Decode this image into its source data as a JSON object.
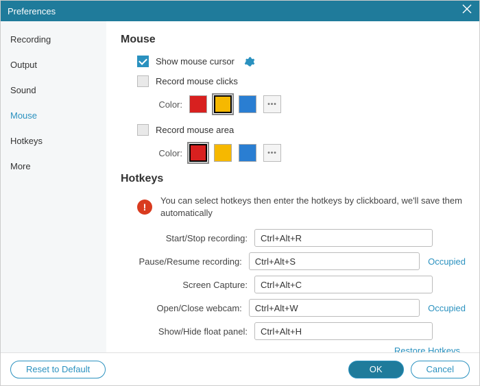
{
  "window": {
    "title": "Preferences"
  },
  "sidebar": {
    "items": [
      {
        "label": "Recording"
      },
      {
        "label": "Output"
      },
      {
        "label": "Sound"
      },
      {
        "label": "Mouse"
      },
      {
        "label": "Hotkeys"
      },
      {
        "label": "More"
      }
    ],
    "active_index": 3
  },
  "mouse": {
    "heading": "Mouse",
    "show_cursor_label": "Show mouse cursor",
    "show_cursor_checked": true,
    "record_clicks_label": "Record mouse clicks",
    "record_clicks_checked": false,
    "record_area_label": "Record mouse area",
    "record_area_checked": false,
    "color_label": "Color:",
    "clicks_colors": [
      "#d8201f",
      "#f6b800",
      "#2a7ed2"
    ],
    "clicks_selected_index": 1,
    "area_colors": [
      "#d8201f",
      "#f6b800",
      "#2a7ed2"
    ],
    "area_selected_index": 0,
    "more_glyph": "•••"
  },
  "hotkeys": {
    "heading": "Hotkeys",
    "alert_text": "You can select hotkeys then enter the hotkeys by clickboard, we'll save them automatically",
    "occupied_label": "Occupied",
    "restore_label": "Restore Hotkeys",
    "rows": [
      {
        "label": "Start/Stop recording:",
        "value": "Ctrl+Alt+R",
        "occupied": false
      },
      {
        "label": "Pause/Resume recording:",
        "value": "Ctrl+Alt+S",
        "occupied": true
      },
      {
        "label": "Screen Capture:",
        "value": "Ctrl+Alt+C",
        "occupied": false
      },
      {
        "label": "Open/Close webcam:",
        "value": "Ctrl+Alt+W",
        "occupied": true
      },
      {
        "label": "Show/Hide float panel:",
        "value": "Ctrl+Alt+H",
        "occupied": false
      }
    ]
  },
  "footer": {
    "reset_label": "Reset to Default",
    "ok_label": "OK",
    "cancel_label": "Cancel"
  }
}
